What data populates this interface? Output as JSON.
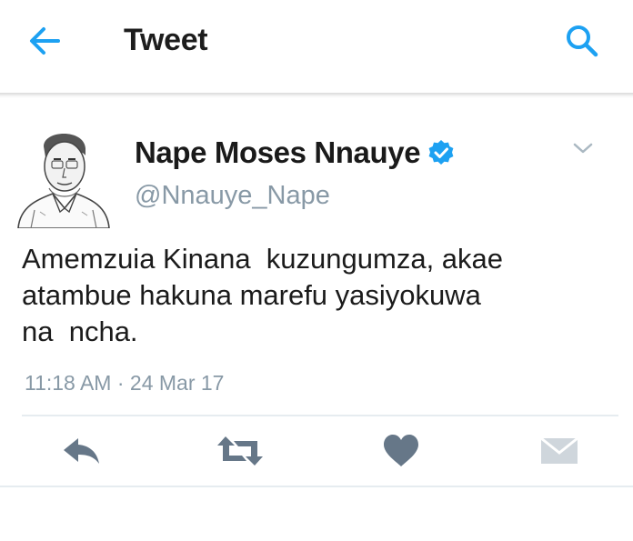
{
  "header": {
    "title": "Tweet",
    "back_icon": "back-arrow-icon",
    "search_icon": "search-icon"
  },
  "tweet": {
    "author_name": "Nape Moses Nnauye",
    "handle": "@Nnauye_Nape",
    "verified": true,
    "text": "Amemzuia Kinana  kuzungumza, akae\natambue hakuna marefu yasiyokuwa\nna  ncha.",
    "timestamp": "11:18 AM · 24 Mar 17"
  },
  "actions": [
    {
      "name": "reply",
      "icon": "reply-icon"
    },
    {
      "name": "retweet",
      "icon": "retweet-icon"
    },
    {
      "name": "like",
      "icon": "heart-icon"
    },
    {
      "name": "message",
      "icon": "envelope-icon"
    }
  ],
  "colors": {
    "accent": "#1da1f2",
    "icon_gray": "#667788",
    "secondary_text": "#8899a6"
  }
}
